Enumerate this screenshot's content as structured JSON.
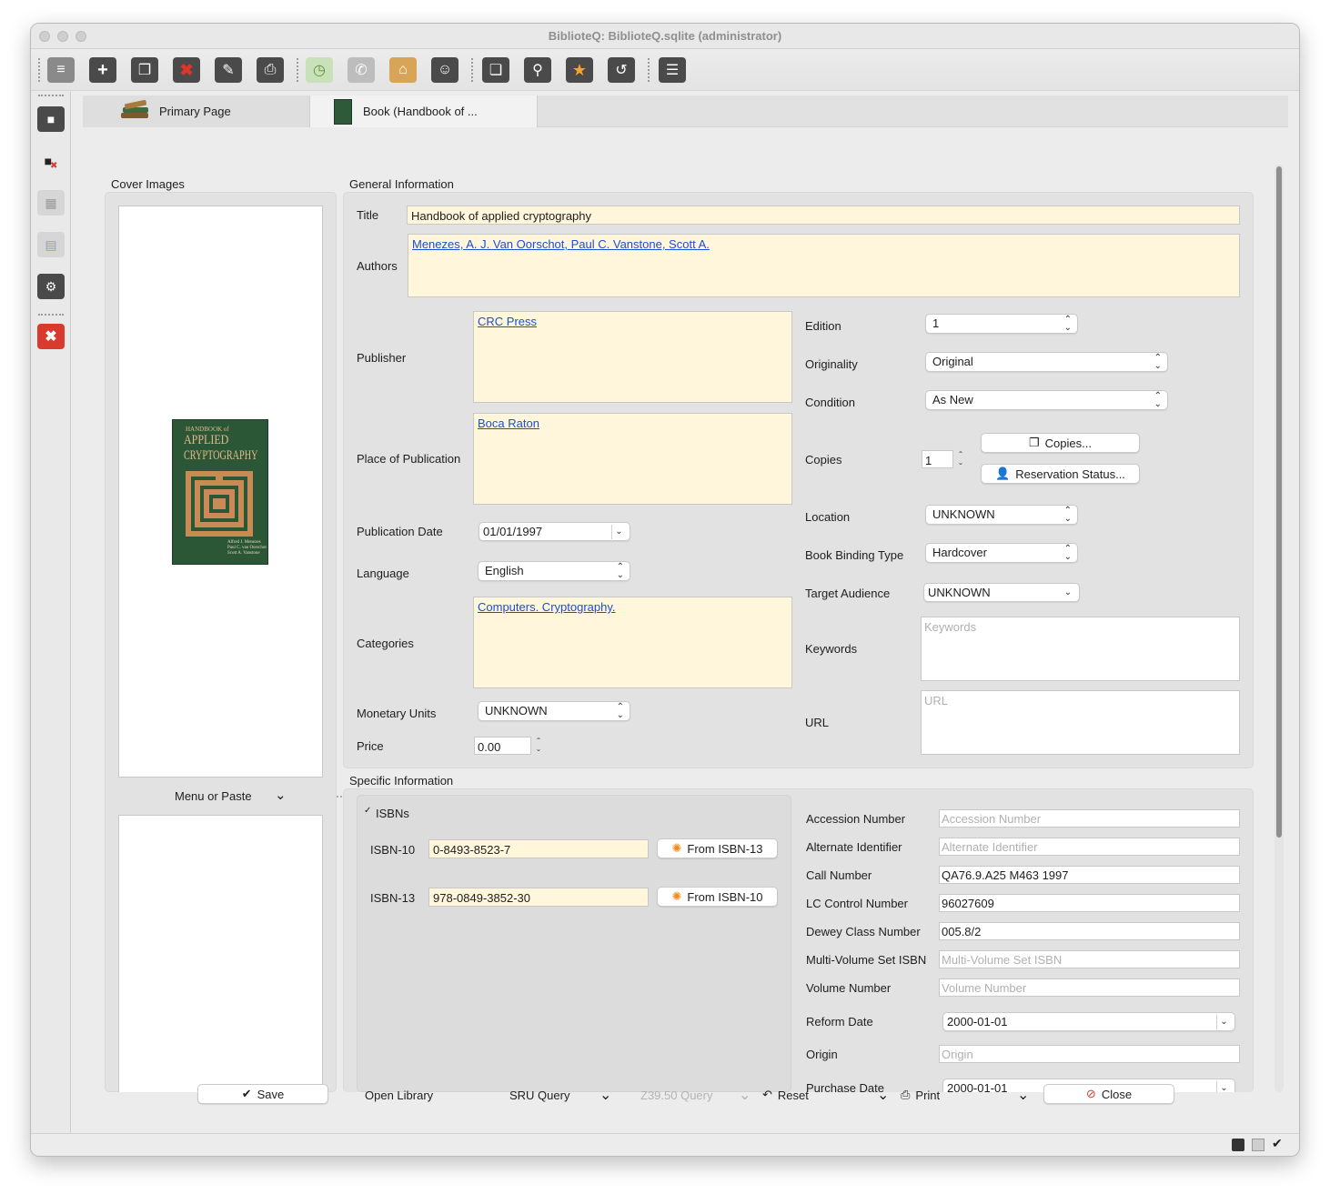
{
  "window": {
    "title": "BiblioteQ: BiblioteQ.sqlite (administrator)"
  },
  "toolbar": {
    "icons": [
      "list-view-icon",
      "add-icon",
      "duplicate-icon",
      "delete-icon",
      "modify-icon",
      "print-icon",
      "clock-icon",
      "phone-icon",
      "home-icon",
      "members-icon",
      "copy-icon",
      "search-icon",
      "favorite-star-icon",
      "refresh-icon",
      "detail-list-icon"
    ]
  },
  "tabs": [
    {
      "label": "Primary Page",
      "icon": "books-icon"
    },
    {
      "label": "Book (Handbook of ...",
      "icon": "book-cover-icon"
    }
  ],
  "cover": {
    "section_label": "Cover Images",
    "image_title_lines": [
      "HANDBOOK of",
      "APPLIED",
      "CRYPTOGRAPHY"
    ],
    "image_authors": [
      "Alfred J. Menezes",
      "Paul C. van Oorschot",
      "Scott A. Vanstone"
    ],
    "menu_label": "Menu or Paste"
  },
  "general": {
    "section_label": "General Information",
    "title_label": "Title",
    "title_value": "Handbook of applied cryptography",
    "authors_label": "Authors",
    "authors_value": "Menezes, A. J. Van Oorschot, Paul C. Vanstone, Scott A.",
    "publisher_label": "Publisher",
    "publisher_value": "CRC Press",
    "place_label": "Place of Publication",
    "place_value": "Boca Raton",
    "pubdate_label": "Publication Date",
    "pubdate_value": "01/01/1997",
    "language_label": "Language",
    "language_value": "English",
    "categories_label": "Categories",
    "categories_value": "Computers. Cryptography.",
    "monetary_label": "Monetary Units",
    "monetary_value": "UNKNOWN",
    "price_label": "Price",
    "price_value": "0.00",
    "edition_label": "Edition",
    "edition_value": "1",
    "originality_label": "Originality",
    "originality_value": "Original",
    "condition_label": "Condition",
    "condition_value": "As New",
    "copies_label": "Copies",
    "copies_value": "1",
    "copies_button": "Copies...",
    "reservation_button": "Reservation Status...",
    "location_label": "Location",
    "location_value": "UNKNOWN",
    "binding_label": "Book Binding Type",
    "binding_value": "Hardcover",
    "audience_label": "Target Audience",
    "audience_value": "UNKNOWN",
    "keywords_label": "Keywords",
    "keywords_placeholder": "Keywords",
    "url_label": "URL",
    "url_placeholder": "URL"
  },
  "specific": {
    "section_label": "Specific Information",
    "isbns_label": "ISBNs",
    "isbns_checked": true,
    "isbn10_label": "ISBN-10",
    "isbn10_value": "0-8493-8523-7",
    "from13_button": "From ISBN-13",
    "isbn13_label": "ISBN-13",
    "isbn13_value": "978-0849-3852-30",
    "from10_button": "From ISBN-10",
    "accession_label": "Accession Number",
    "accession_placeholder": "Accession Number",
    "alternate_label": "Alternate Identifier",
    "alternate_placeholder": "Alternate Identifier",
    "callnum_label": "Call Number",
    "callnum_value": "QA76.9.A25 M463 1997",
    "lccn_label": "LC Control Number",
    "lccn_value": "96027609",
    "dewey_label": "Dewey Class Number",
    "dewey_value": "005.8/2",
    "multivol_label": "Multi-Volume Set ISBN",
    "multivol_placeholder": "Multi-Volume Set ISBN",
    "volume_label": "Volume Number",
    "volume_placeholder": "Volume Number",
    "reform_label": "Reform Date",
    "reform_value": "2000-01-01",
    "origin_label": "Origin",
    "origin_placeholder": "Origin",
    "purchase_label": "Purchase Date",
    "purchase_value": "2000-01-01"
  },
  "bottom": {
    "save": "Save",
    "open_library": "Open Library",
    "sru": "SRU Query",
    "z3950": "Z39.50 Query",
    "reset": "Reset",
    "print": "Print",
    "close": "Close"
  },
  "colors": {
    "required_field": "#fff6dc",
    "link": "#1a4fd1",
    "delete_red": "#d83a2e"
  }
}
